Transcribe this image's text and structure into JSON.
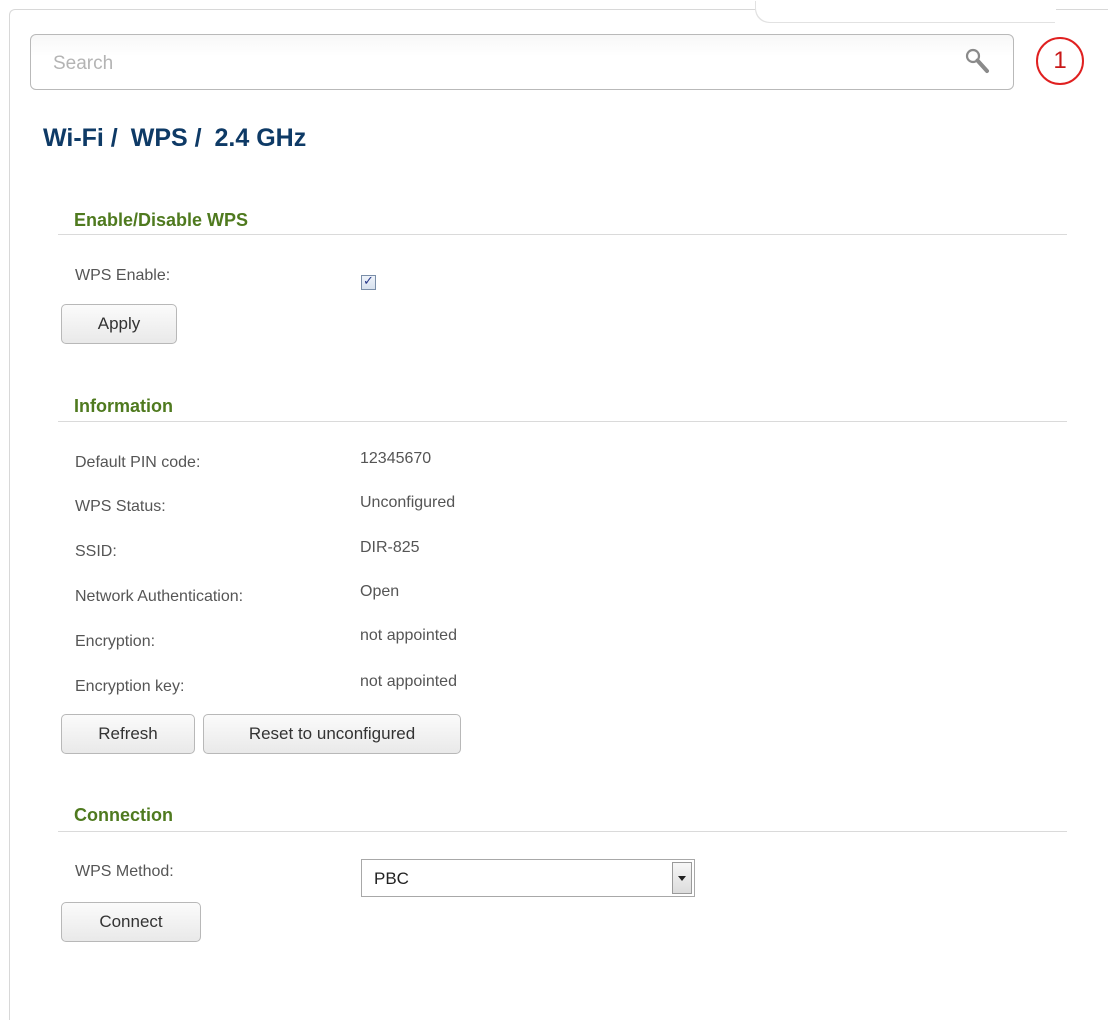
{
  "search": {
    "placeholder": "Search"
  },
  "notifications": {
    "count": "1"
  },
  "breadcrumb": {
    "items": [
      "Wi-Fi /",
      "WPS /",
      "2.4 GHz"
    ]
  },
  "enable_section": {
    "title": "Enable/Disable WPS",
    "wps_enable_label": "WPS Enable:",
    "wps_enabled": true,
    "apply_label": "Apply"
  },
  "info_section": {
    "title": "Information",
    "rows": [
      {
        "label": "Default PIN code:",
        "value": "12345670"
      },
      {
        "label": "WPS Status:",
        "value": "Unconfigured"
      },
      {
        "label": "SSID:",
        "value": "DIR-825"
      },
      {
        "label": "Network Authentication:",
        "value": "Open"
      },
      {
        "label": "Encryption:",
        "value": "not appointed"
      },
      {
        "label": "Encryption key:",
        "value": "not appointed"
      }
    ],
    "refresh_label": "Refresh",
    "reset_label": "Reset to unconfigured"
  },
  "connection_section": {
    "title": "Connection",
    "method_label": "WPS Method:",
    "method_value": "PBC",
    "connect_label": "Connect"
  }
}
